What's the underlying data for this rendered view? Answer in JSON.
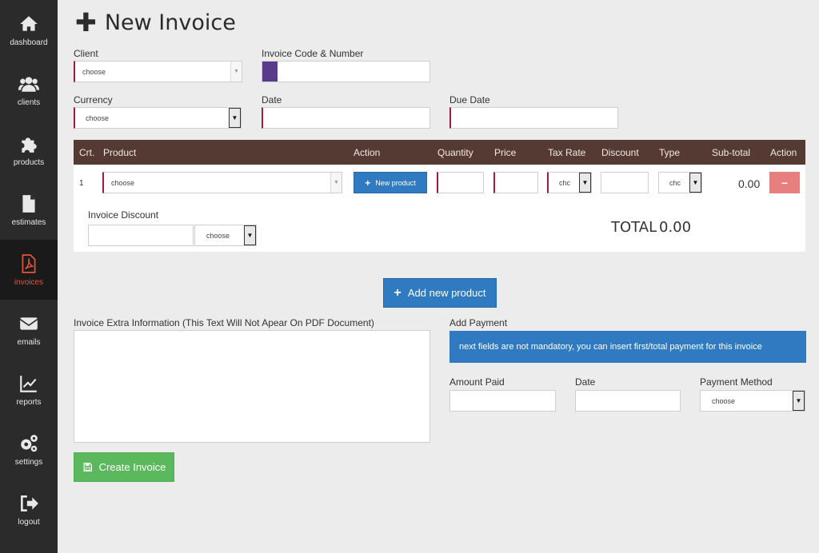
{
  "sidebar": {
    "items": [
      {
        "label": "dashboard",
        "icon": "home-icon"
      },
      {
        "label": "clients",
        "icon": "users-icon"
      },
      {
        "label": "products",
        "icon": "puzzle-icon"
      },
      {
        "label": "estimates",
        "icon": "file-icon"
      },
      {
        "label": "invoices",
        "icon": "pdf-icon",
        "active": true
      },
      {
        "label": "emails",
        "icon": "envelope-icon"
      },
      {
        "label": "reports",
        "icon": "chart-icon"
      },
      {
        "label": "settings",
        "icon": "gears-icon"
      },
      {
        "label": "logout",
        "icon": "logout-icon"
      }
    ]
  },
  "page": {
    "title": "New Invoice"
  },
  "form": {
    "client_label": "Client",
    "client_value": "choose",
    "invoice_code_label": "Invoice Code & Number",
    "currency_label": "Currency",
    "currency_value": "choose",
    "date_label": "Date",
    "due_date_label": "Due Date"
  },
  "table": {
    "headers": [
      "Crt.",
      "Product",
      "Action",
      "Quantity",
      "Price",
      "Tax Rate",
      "Discount",
      "Type",
      "Sub-total",
      "Action"
    ],
    "row": {
      "crt": "1",
      "product_value": "choose",
      "new_product_label": "New product",
      "tax_value": "chc",
      "type_value": "chc",
      "subtotal": "0.00",
      "remove_label": "−"
    },
    "invoice_discount_label": "Invoice Discount",
    "discount_type_value": "choose",
    "total_label": "TOTAL",
    "total_value": "0.00"
  },
  "add_new_product_label": "Add new product",
  "extra_info_label": "Invoice Extra Information (This Text Will Not Apear On PDF Document)",
  "payment": {
    "title": "Add Payment",
    "notice": "next fields are not mandatory, you can insert first/total payment for this invoice",
    "amount_label": "Amount Paid",
    "date_label": "Date",
    "method_label": "Payment Method",
    "method_value": "choose"
  },
  "create_label": "Create Invoice",
  "colors": {
    "sidebar_bg": "#2b2b2b",
    "active": "#e4553a",
    "table_header": "#553a34",
    "primary": "#2f7ac0",
    "success": "#5cb85c",
    "danger": "#e87f7f",
    "required_border": "#a01c3a"
  }
}
